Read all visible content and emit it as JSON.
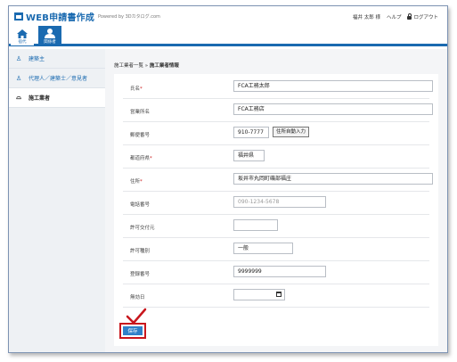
{
  "app": {
    "logo_text": "WEB申請書作成",
    "powered_by": "Powered by 3Dカタログ.com"
  },
  "header": {
    "user": "福井 太郎 様",
    "help": "ヘルプ",
    "logout": "ログアウト"
  },
  "nav": {
    "home_label": "宿代",
    "app_label": "関係者"
  },
  "sidebar": {
    "items": [
      {
        "label": "建築主",
        "icon": "person-icon"
      },
      {
        "label": "代理人／建築士／意見者",
        "icon": "people-icon"
      },
      {
        "label": "施工業者",
        "icon": "helmet-icon"
      }
    ]
  },
  "breadcrumb": {
    "parent": "施工業者一覧",
    "separator": "»",
    "current": "施工業者情報"
  },
  "form": {
    "name_label": "氏名",
    "name_value": "FCA工務太郎",
    "company_label": "営業所名",
    "company_value": "FCA工務店",
    "postal_label": "郵便番号",
    "postal_value": "910-7777",
    "postal_button": "住所自動入力",
    "pref_label": "都道府県",
    "pref_value": "福井県",
    "address_label": "住所",
    "address_value": "坂井市丸岡町磯部福庄",
    "phone_label": "電話番号",
    "phone_placeholder": "090-1234-5678",
    "permit_issuer_label": "許可交付元",
    "permit_issuer_value": "",
    "permit_type_label": "許可種別",
    "permit_type_value": "一般",
    "reg_no_label": "登録番号",
    "reg_no_value": "9999999",
    "expiry_label": "無効日",
    "expiry_value": "",
    "required_mark": "*"
  },
  "save_button": "保存",
  "colors": {
    "brand": "#1a6ab0",
    "save": "#2f80c8",
    "highlight": "#c8161d",
    "required": "#cc2222"
  }
}
